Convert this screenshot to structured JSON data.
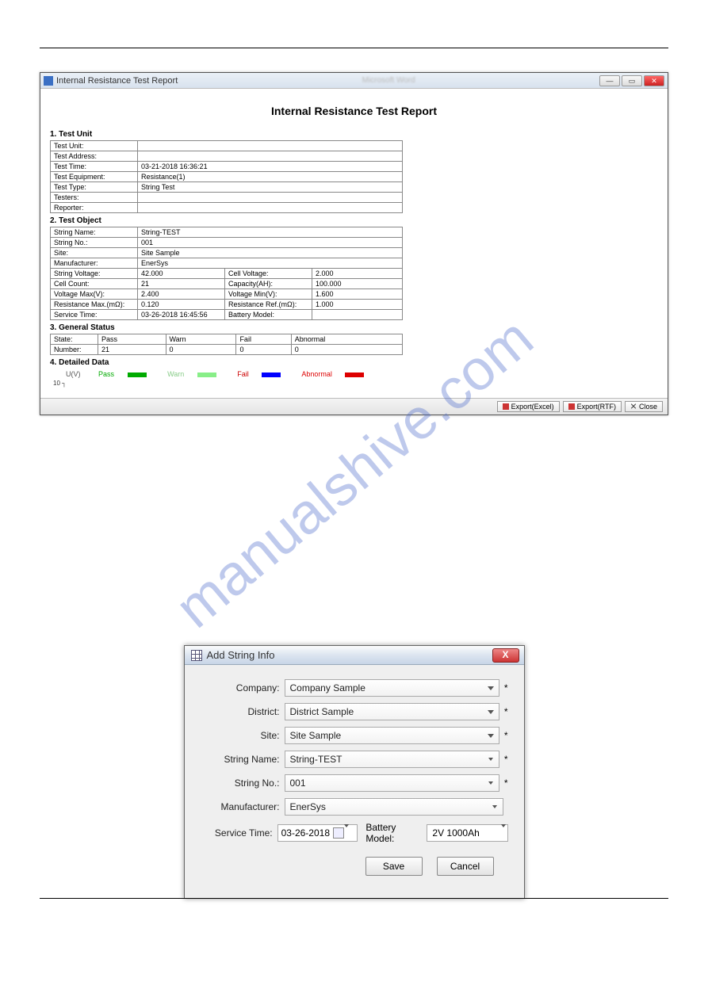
{
  "watermark": "manualshive.com",
  "report": {
    "windowTitle": "Internal Resistance Test Report",
    "title": "Internal Resistance Test Report",
    "section1": {
      "heading": "1. Test Unit",
      "rows": [
        {
          "label": "Test Unit:",
          "value": ""
        },
        {
          "label": "Test Address:",
          "value": ""
        },
        {
          "label": "Test Time:",
          "value": "03-21-2018 16:36:21"
        },
        {
          "label": "Test Equipment:",
          "value": "Resistance(1)"
        },
        {
          "label": "Test Type:",
          "value": "String Test"
        },
        {
          "label": "Testers:",
          "value": ""
        },
        {
          "label": "Reporter:",
          "value": ""
        }
      ]
    },
    "section2": {
      "heading": "2. Test Object",
      "single": [
        {
          "label": "String Name:",
          "value": "String-TEST"
        },
        {
          "label": "String No.:",
          "value": "001"
        },
        {
          "label": "Site:",
          "value": "Site Sample"
        },
        {
          "label": "Manufacturer:",
          "value": "EnerSys"
        }
      ],
      "grid": [
        {
          "l1": "String Voltage:",
          "v1": "42.000",
          "l2": "Cell Voltage:",
          "v2": "2.000"
        },
        {
          "l1": "Cell Count:",
          "v1": "21",
          "l2": "Capacity(AH):",
          "v2": "100.000"
        },
        {
          "l1": "Voltage Max(V):",
          "v1": "2.400",
          "l2": "Voltage Min(V):",
          "v2": "1.600"
        },
        {
          "l1": "Resistance Max.(mΩ):",
          "v1": "0.120",
          "l2": "Resistance Ref.(mΩ):",
          "v2": "1.000"
        },
        {
          "l1": "Service Time:",
          "v1": "03-26-2018 16:45:56",
          "l2": "Battery Model:",
          "v2": ""
        }
      ]
    },
    "section3": {
      "heading": "3. General Status",
      "headers": [
        "State:",
        "Pass",
        "Warn",
        "Fail",
        "Abnormal"
      ],
      "values": [
        "Number:",
        "21",
        "0",
        "0",
        "0"
      ]
    },
    "section4": {
      "heading": "4. Detailed Data",
      "legend": {
        "pass": "Pass",
        "warn": "Warn",
        "fail": "Fail",
        "abnormal": "Abnormal"
      },
      "yAxisLabel": "U(V)",
      "yTick": "10"
    },
    "footer": {
      "exportExcel": "Export(Excel)",
      "exportRtf": "Export(RTF)",
      "close": "Close"
    }
  },
  "dialog": {
    "title": "Add String Info",
    "fields": {
      "company": {
        "label": "Company:",
        "value": "Company Sample",
        "required": "*"
      },
      "district": {
        "label": "District:",
        "value": "District Sample",
        "required": "*"
      },
      "site": {
        "label": "Site:",
        "value": "Site Sample",
        "required": "*"
      },
      "stringName": {
        "label": "String Name:",
        "value": "String-TEST",
        "required": "*"
      },
      "stringNo": {
        "label": "String No.:",
        "value": "001",
        "required": "*"
      },
      "manufacturer": {
        "label": "Manufacturer:",
        "value": "EnerSys"
      },
      "serviceTime": {
        "label": "Service Time:",
        "value": "03-26-2018"
      },
      "batteryModel": {
        "label": "Battery Model:",
        "value": "2V 1000Ah"
      }
    },
    "buttons": {
      "save": "Save",
      "cancel": "Cancel"
    }
  }
}
